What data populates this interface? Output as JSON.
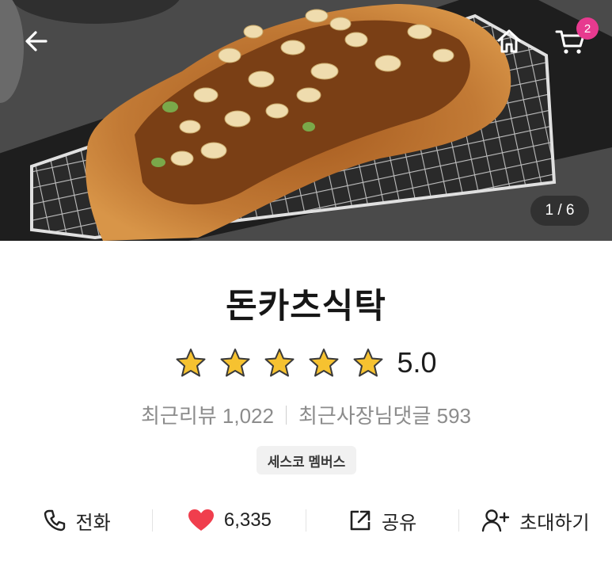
{
  "header": {
    "back_icon": "arrow-left-icon",
    "home_icon": "home-icon",
    "cart_icon": "cart-icon",
    "cart_count": "2",
    "image_counter": "1 / 6"
  },
  "store": {
    "name": "돈카츠식탁",
    "rating": "5.0",
    "stars": 5,
    "recent_reviews_label": "최근리뷰 1,022",
    "recent_owner_replies_label": "최근사장님댓글 593",
    "badge": "세스코 멤버스"
  },
  "actions": [
    {
      "icon": "phone-icon",
      "label": "전화"
    },
    {
      "icon": "heart-icon",
      "label": "6,335"
    },
    {
      "icon": "share-icon",
      "label": "공유"
    },
    {
      "icon": "invite-icon",
      "label": "초대하기"
    }
  ],
  "colors": {
    "accent_badge": "#e73a8f",
    "star": "#f6c230",
    "heart": "#f03e4d"
  }
}
